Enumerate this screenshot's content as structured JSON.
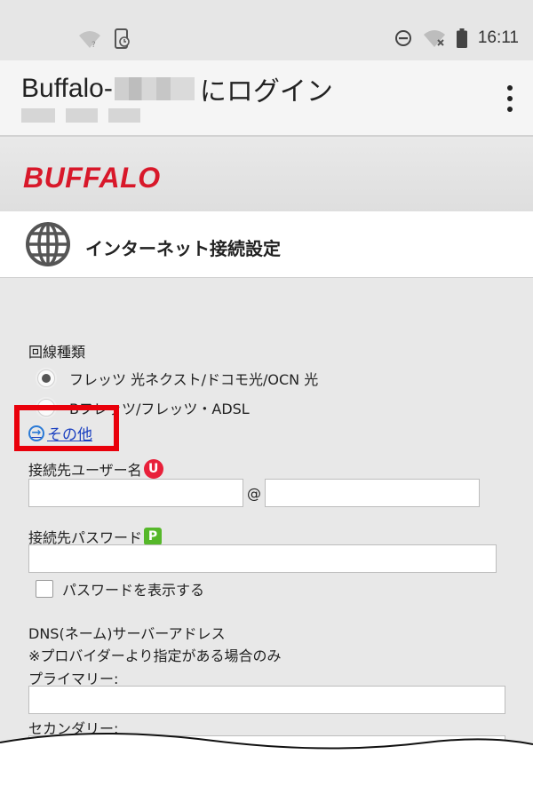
{
  "status_bar": {
    "time": "16:11",
    "left_icons": [
      "wifi-unknown-icon",
      "phone-clock-icon"
    ],
    "right_icons": [
      "do-not-disturb-icon",
      "wifi-off-icon",
      "battery-icon"
    ]
  },
  "app_bar": {
    "title_prefix": "Buffalo-",
    "title_suffix": "にログイン",
    "menu_icon": "more-vert-icon"
  },
  "brand": {
    "logo_text": "BUFFALO",
    "color": "#d8182a"
  },
  "section": {
    "icon": "globe-icon",
    "title": "インターネット接続設定"
  },
  "form": {
    "line_type": {
      "label": "回線種類",
      "options": [
        {
          "label": "フレッツ 光ネクスト/ドコモ光/OCN 光",
          "selected": true
        },
        {
          "label": "Bフレッツ/フレッツ・ADSL",
          "selected": false
        }
      ],
      "other_link": "その他"
    },
    "username": {
      "label": "接続先ユーザー名",
      "badge": "U",
      "at": "@",
      "value_user": "",
      "value_domain": ""
    },
    "password": {
      "label": "接続先パスワード",
      "badge": "P",
      "value": "",
      "show_password_label": "パスワードを表示する",
      "show_password_checked": false
    },
    "dns": {
      "label": "DNS(ネーム)サーバーアドレス",
      "note": "※プロバイダーより指定がある場合のみ",
      "primary_label": "プライマリー:",
      "primary_value": "",
      "secondary_label": "セカンダリー:",
      "secondary_value": ""
    }
  },
  "colors": {
    "highlight": "#e9000b",
    "link": "#1a3fc0",
    "badge_u": "#e8203a",
    "badge_p": "#56b82a"
  }
}
